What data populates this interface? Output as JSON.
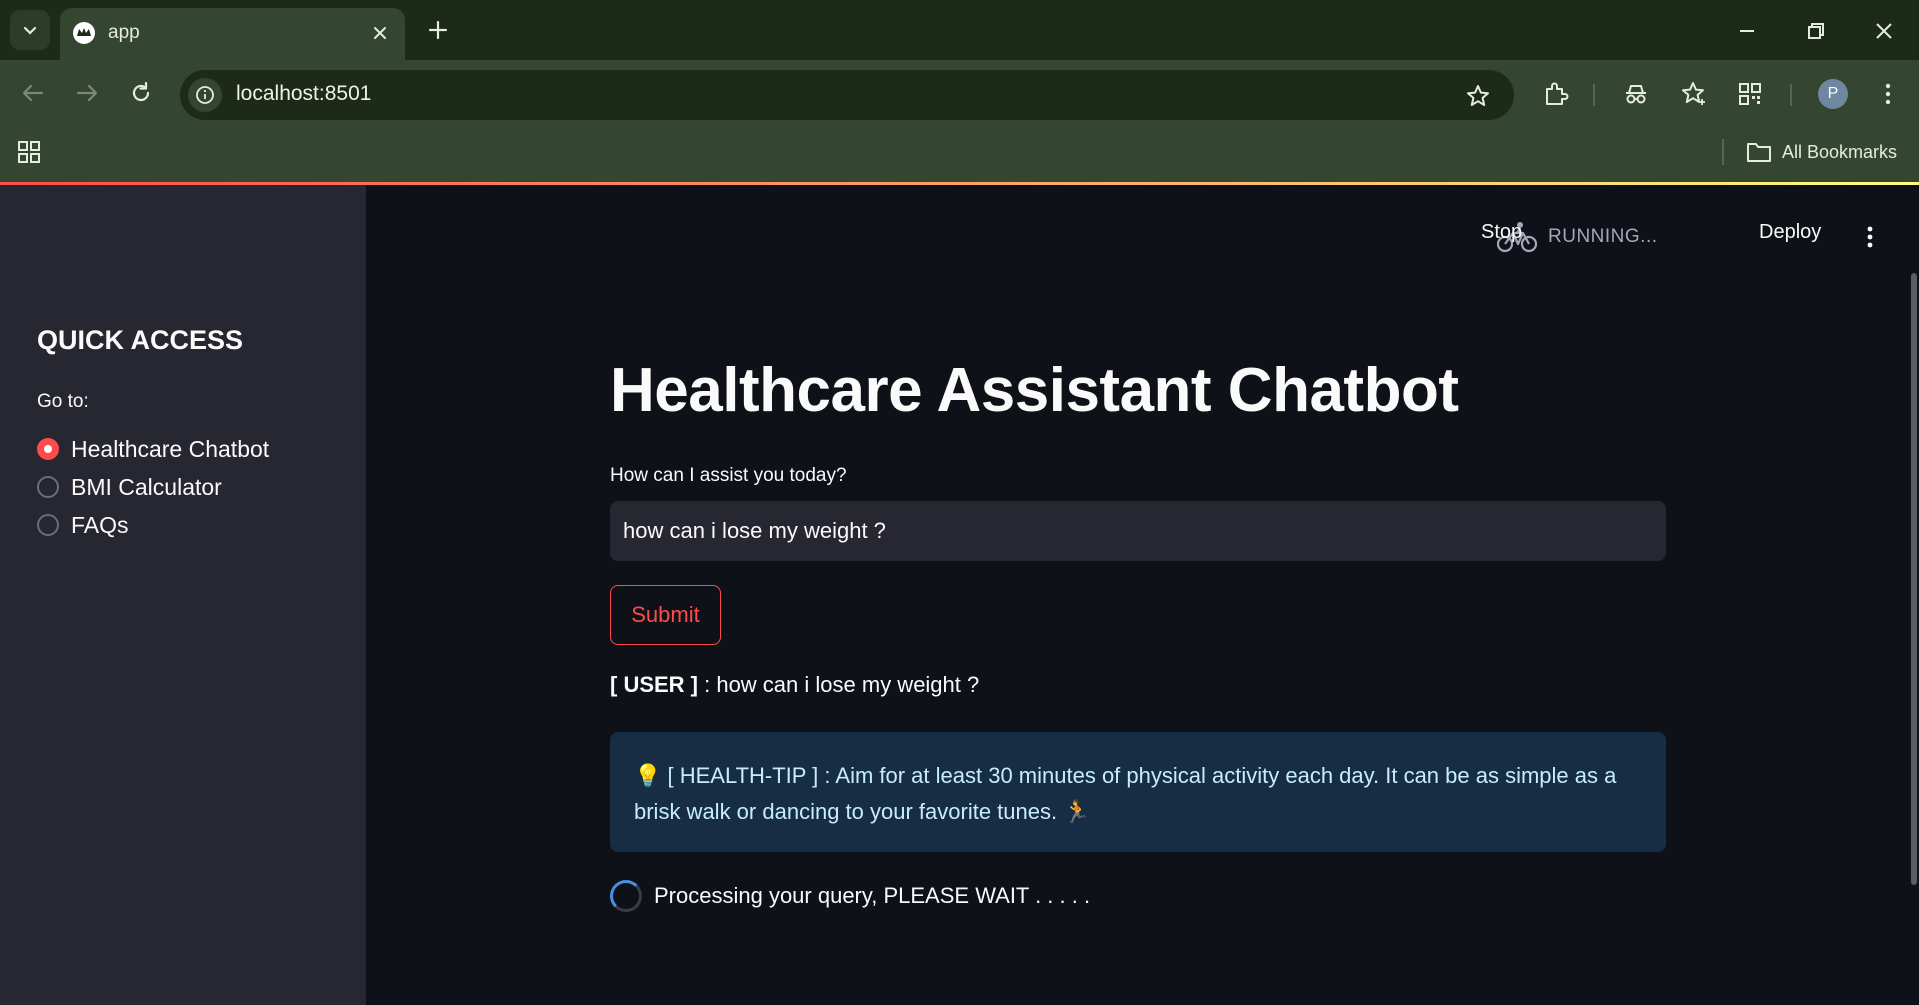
{
  "browser": {
    "tab_title": "app",
    "url": "localhost:8501",
    "avatar_initial": "P",
    "bookmarks_label": "All Bookmarks"
  },
  "header": {
    "status": "RUNNING...",
    "stop_label": "Stop",
    "deploy_label": "Deploy"
  },
  "sidebar": {
    "title": "QUICK ACCESS",
    "goto_label": "Go to:",
    "options": [
      {
        "label": "Healthcare Chatbot",
        "selected": true
      },
      {
        "label": "BMI Calculator",
        "selected": false
      },
      {
        "label": "FAQs",
        "selected": false
      }
    ]
  },
  "main": {
    "title": "Healthcare Assistant Chatbot",
    "input_label": "How can I assist you today?",
    "input_value": "how can i lose my weight ?",
    "submit_label": "Submit",
    "user_prefix": "[ USER ]",
    "user_message": " : how can i lose my weight ?",
    "health_tip": "💡 [ HEALTH-TIP ] : Aim for at least 30 minutes of physical activity each day. It can be as simple as a brisk walk or dancing to your favorite tunes. 🏃",
    "processing_text": "Processing your query, PLEASE WAIT . . . . ."
  },
  "colors": {
    "primary": "#ff4b4b",
    "background": "#0e1117",
    "sidebar_bg": "#262730",
    "info_bg": "#172d43",
    "info_text": "#c7ebff",
    "browser_frame": "#344530"
  }
}
